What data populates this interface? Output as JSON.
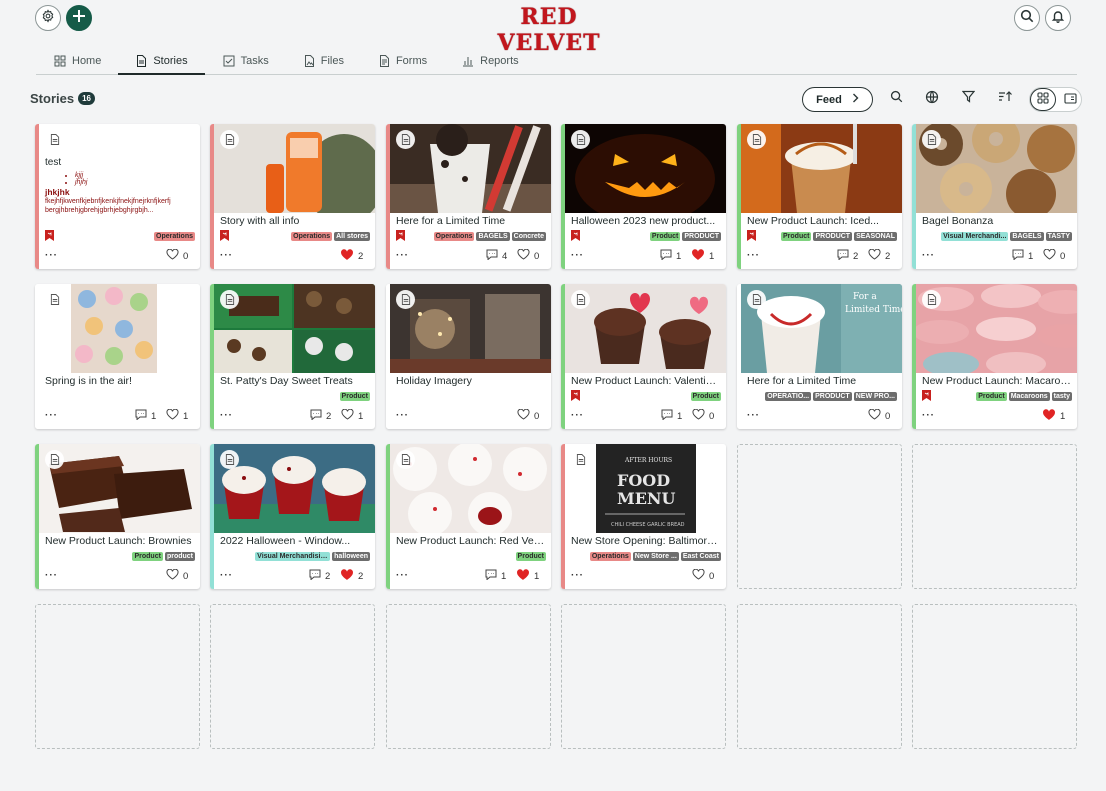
{
  "app": {
    "logo": "RED VELVET"
  },
  "header": {
    "settings_icon": "gear-icon",
    "add_icon": "plus-icon",
    "search_icon": "search-icon",
    "notify_icon": "bell-icon"
  },
  "tabs": [
    {
      "label": "Home",
      "icon": "grid-icon"
    },
    {
      "label": "Stories",
      "icon": "document-icon",
      "active": true
    },
    {
      "label": "Tasks",
      "icon": "checkbox-icon"
    },
    {
      "label": "Files",
      "icon": "file-image-icon"
    },
    {
      "label": "Forms",
      "icon": "form-icon"
    },
    {
      "label": "Reports",
      "icon": "bar-chart-icon"
    }
  ],
  "toolbar": {
    "title": "Stories",
    "count": "16",
    "feed_label": "Feed",
    "view_mode": "grid"
  },
  "colors": {
    "brand": "#155b48",
    "logo_red": "#c2161d",
    "liked": "#e02424",
    "operations": "#e88987",
    "product": "#7fd27f",
    "visual_merch": "#92e0d6"
  },
  "stories": [
    {
      "title": "test",
      "type": "text",
      "accent": "#e88987",
      "body": {
        "bullets": [
          "kjjj",
          "jhjhj"
        ],
        "heading": "jhkjhk",
        "para": "fkejhfjkwenfkjebnfjkenkjfnekjfnejrknfjkerfj bergjhbrehjgbrehjgbrhjebghjrgbjh..."
      },
      "bookmark": true,
      "tags": [
        [
          "Operations",
          "operations"
        ]
      ],
      "comments": null,
      "likes": "0",
      "liked": false
    },
    {
      "title": "Story with all info",
      "accent": "#e88987",
      "image": "orange-skincare-products",
      "bookmark": true,
      "tags": [
        [
          "Operations",
          "operations"
        ],
        [
          "All stores",
          "dark"
        ]
      ],
      "comments": null,
      "likes": "2",
      "liked": true
    },
    {
      "title": "Here for a Limited Time",
      "accent": "#e88987",
      "image": "cookies-and-cream-shake",
      "bookmark": true,
      "tags": [
        [
          "Operations",
          "operations"
        ],
        [
          "BAGELS",
          "dark"
        ],
        [
          "Concrete",
          "dark"
        ]
      ],
      "comments": "4",
      "likes": "0",
      "liked": false
    },
    {
      "title": "Halloween 2023 new product...",
      "accent": "#7fd27f",
      "image": "jack-o-lantern",
      "bookmark": true,
      "tags": [
        [
          "Product",
          "product"
        ],
        [
          "PRODUCT",
          "dark"
        ]
      ],
      "comments": "1",
      "likes": "1",
      "liked": true
    },
    {
      "title": "New Product Launch: Iced...",
      "accent": "#7fd27f",
      "image": "iced-caramel-drink",
      "bookmark": true,
      "tags": [
        [
          "Product",
          "product"
        ],
        [
          "PRODUCT",
          "dark"
        ],
        [
          "SEASONAL",
          "dark"
        ]
      ],
      "comments": "2",
      "likes": "2",
      "liked": false
    },
    {
      "title": "Bagel Bonanza",
      "accent": "#92e0d6",
      "image": "bagels",
      "bookmark": false,
      "tags": [
        [
          "Visual Merchandi...",
          "teal"
        ],
        [
          "BAGELS",
          "dark"
        ],
        [
          "TASTY",
          "dark"
        ]
      ],
      "comments": "1",
      "likes": "0",
      "liked": false
    },
    {
      "title": "Spring is in the air!",
      "accent": "#ffffff",
      "image": "spring-cupcakes",
      "bookmark": false,
      "tags": [],
      "comments": "1",
      "likes": "1",
      "liked": false
    },
    {
      "title": "St. Patty's Day Sweet Treats",
      "accent": "#7fd27f",
      "image": "green-treats",
      "bookmark": false,
      "tags": [
        [
          "Product",
          "product"
        ]
      ],
      "comments": "2",
      "likes": "1",
      "liked": false
    },
    {
      "title": "Holiday Imagery",
      "accent": "#ffffff",
      "image": "holiday-bakery",
      "bookmark": false,
      "tags": [],
      "comments": null,
      "likes": "0",
      "liked": false
    },
    {
      "title": "New Product Launch: Valentine...",
      "accent": "#7fd27f",
      "image": "valentine-cupcakes",
      "bookmark": true,
      "tags": [
        [
          "Product",
          "product"
        ]
      ],
      "comments": "1",
      "likes": "0",
      "liked": false
    },
    {
      "title": "Here for a Limited Time",
      "accent": "#ffffff",
      "image": "peppermint-shake",
      "bookmark": false,
      "tags": [
        [
          "OPERATIO...",
          "dark"
        ],
        [
          "PRODUCT",
          "dark"
        ],
        [
          "NEW PRO...",
          "dark"
        ]
      ],
      "comments": null,
      "likes": "0",
      "liked": false
    },
    {
      "title": "New Product Launch: Macaroons",
      "accent": "#7fd27f",
      "image": "macarons",
      "bookmark": true,
      "tags": [
        [
          "Product",
          "product"
        ],
        [
          "Macaroons",
          "dark"
        ],
        [
          "tasty",
          "dark"
        ]
      ],
      "comments": null,
      "likes": "1",
      "liked": true
    },
    {
      "title": "New Product Launch: Brownies",
      "accent": "#7fd27f",
      "image": "brownies",
      "bookmark": false,
      "tags": [
        [
          "Product",
          "product"
        ],
        [
          "product",
          "dark"
        ]
      ],
      "comments": null,
      "likes": "0",
      "liked": false
    },
    {
      "title": "2022 Halloween - Window...",
      "accent": "#92e0d6",
      "image": "red-velvet-cupcakes",
      "bookmark": false,
      "tags": [
        [
          "Visual Merchandising",
          "teal"
        ],
        [
          "halloween",
          "dark"
        ]
      ],
      "comments": "2",
      "likes": "2",
      "liked": true
    },
    {
      "title": "New Product Launch: Red Velv...",
      "accent": "#7fd27f",
      "image": "red-velvet-cake-balls",
      "bookmark": false,
      "tags": [
        [
          "Product",
          "product"
        ]
      ],
      "comments": "1",
      "likes": "1",
      "liked": true
    },
    {
      "title": "New Store Opening: Baltimore,...",
      "accent": "#e88987",
      "image": "chalkboard-food-menu",
      "bookmark": false,
      "tags": [
        [
          "Operations",
          "operations"
        ],
        [
          "New Store ...",
          "dark"
        ],
        [
          "East Coast",
          "dark"
        ]
      ],
      "comments": null,
      "likes": "0",
      "liked": false
    }
  ],
  "empty_slots": 8
}
